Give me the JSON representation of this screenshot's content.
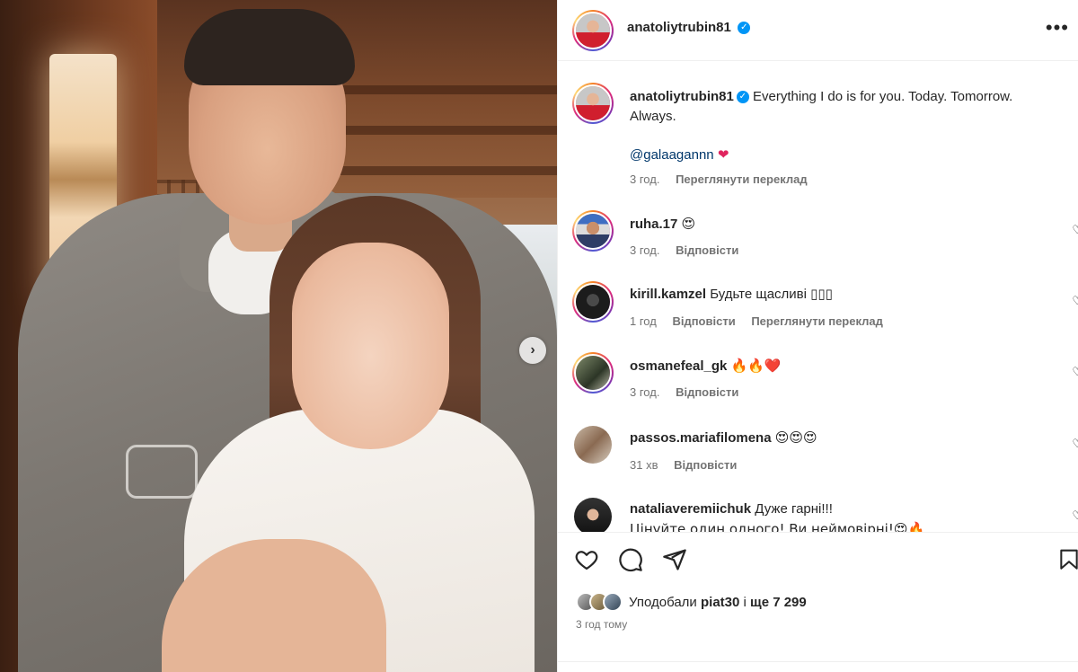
{
  "post": {
    "author": "anatoliytrubin81",
    "caption": "Everything I do is for you. Today. Tomorrow. Always.",
    "mention": "@galaagannn",
    "caption_time": "3 год.",
    "see_translation": "Переглянути переклад",
    "more_icon": "more-horizontal-icon"
  },
  "comments": [
    {
      "user": "ruha.17",
      "text": "😍",
      "time": "3 год.",
      "reply": "Відповісти",
      "translate": ""
    },
    {
      "user": "kirill.kamzel",
      "text": "Будьте щасливі ▯▯▯",
      "time": "1 год",
      "reply": "Відповісти",
      "translate": "Переглянути переклад"
    },
    {
      "user": "osmanefeal_gk",
      "text": "🔥🔥❤️",
      "time": "3 год.",
      "reply": "Відповісти",
      "translate": ""
    },
    {
      "user": "passos.mariafilomena",
      "text": "😍😍😍",
      "time": "31 хв",
      "reply": "Відповісти",
      "translate": ""
    },
    {
      "user": "nataliaveremiichuk",
      "text": "Дуже гарні!!!",
      "text2": "Цінуйте один одного! Ви неймовірні!😍🔥",
      "time": "",
      "reply": "",
      "translate": ""
    }
  ],
  "likes": {
    "prefix": "Уподобали",
    "user": "piat30",
    "middle": "і",
    "count": "ще 7 299"
  },
  "posted_ago": "3 год тому",
  "colors": {
    "link": "#00376b",
    "meta": "#737373",
    "verified": "#0095f6"
  }
}
